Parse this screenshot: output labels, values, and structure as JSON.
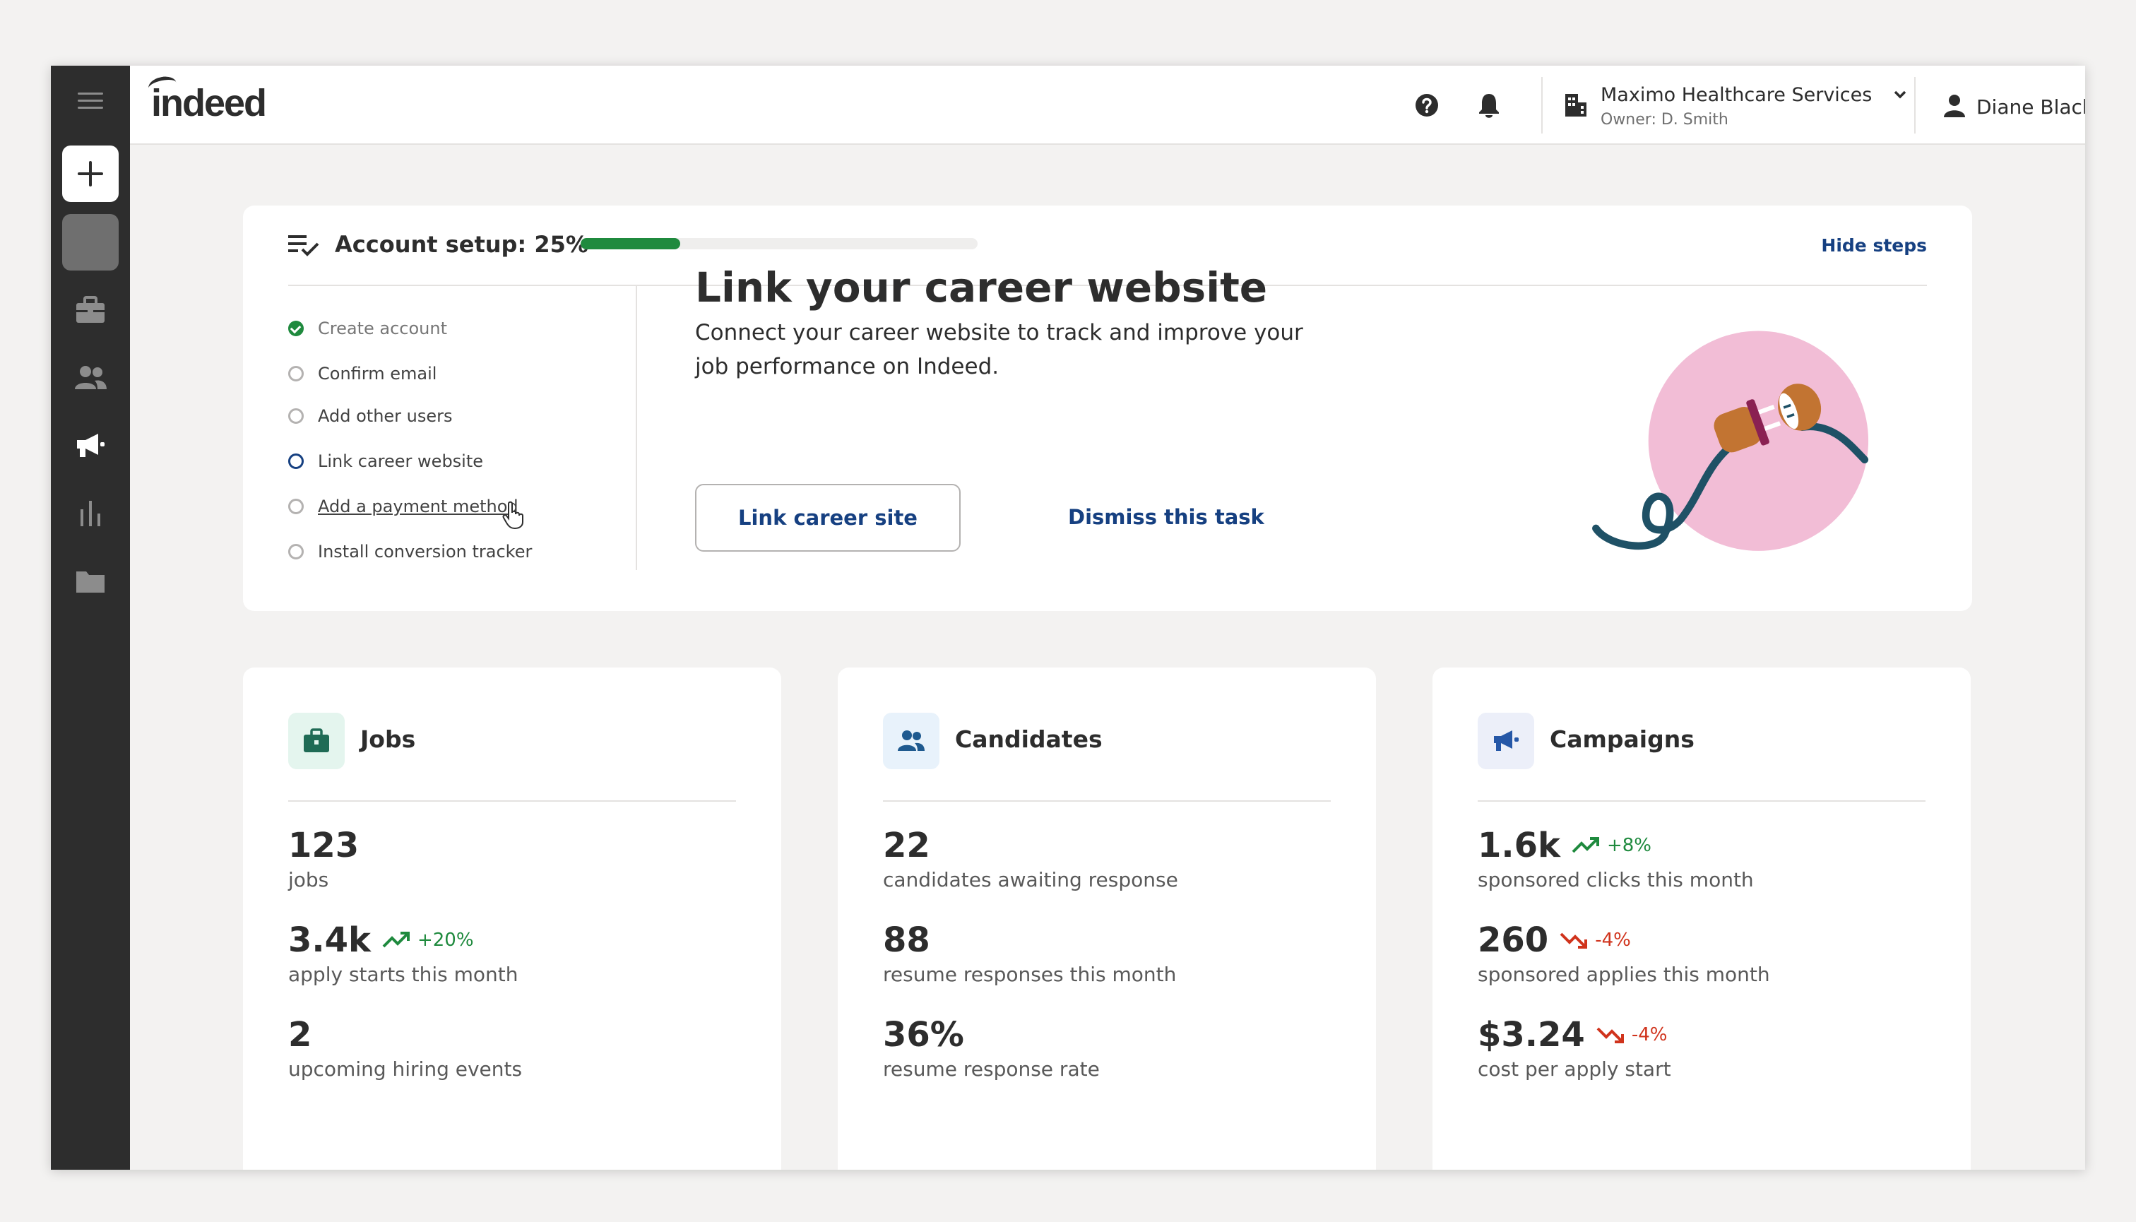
{
  "app": {
    "logo_text": "indeed"
  },
  "sidebar": {
    "items": [
      {
        "name": "menu",
        "icon": "hamburger-icon"
      },
      {
        "name": "create",
        "icon": "plus-icon"
      },
      {
        "name": "blank",
        "icon": ""
      },
      {
        "name": "jobs",
        "icon": "briefcase-icon"
      },
      {
        "name": "candidates",
        "icon": "people-icon"
      },
      {
        "name": "campaigns",
        "icon": "megaphone-icon"
      },
      {
        "name": "analytics",
        "icon": "bar-chart-icon"
      },
      {
        "name": "files",
        "icon": "folder-icon"
      }
    ]
  },
  "header": {
    "company_name": "Maximo Healthcare Services",
    "company_owner": "Owner: D. Smith",
    "user_name": "Diane Black"
  },
  "setup": {
    "title": "Account setup: 25%",
    "progress_fraction": 0.25,
    "hide_label": "Hide steps",
    "steps": [
      {
        "label": "Create account",
        "state": "done"
      },
      {
        "label": "Confirm email",
        "state": "todo"
      },
      {
        "label": "Add other users",
        "state": "todo"
      },
      {
        "label": "Link career website",
        "state": "active"
      },
      {
        "label": "Add a payment method",
        "state": "hover"
      },
      {
        "label": "Install conversion tracker",
        "state": "todo"
      }
    ],
    "task": {
      "title": "Link your career website",
      "description": "Connect your career website to track and improve your job performance on Indeed.",
      "primary_button": "Link career site",
      "secondary_button": "Dismiss this task"
    }
  },
  "cards": {
    "jobs": {
      "title": "Jobs",
      "stats": [
        {
          "value": "123",
          "caption": "jobs",
          "trend": ""
        },
        {
          "value": "3.4k",
          "caption": "apply starts this month",
          "trend": "+20%",
          "direction": "up"
        },
        {
          "value": "2",
          "caption": "upcoming hiring events",
          "trend": ""
        }
      ]
    },
    "candidates": {
      "title": "Candidates",
      "stats": [
        {
          "value": "22",
          "caption": "candidates awaiting response",
          "trend": ""
        },
        {
          "value": "88",
          "caption": "resume responses this month",
          "trend": ""
        },
        {
          "value": "36%",
          "caption": "resume response rate",
          "trend": ""
        }
      ]
    },
    "campaigns": {
      "title": "Campaigns",
      "stats": [
        {
          "value": "1.6k",
          "caption": "sponsored clicks this month",
          "trend": "+8%",
          "direction": "up"
        },
        {
          "value": "260",
          "caption": "sponsored applies this month",
          "trend": "-4%",
          "direction": "down"
        },
        {
          "value": "$3.24",
          "caption": "cost per apply start",
          "trend": "-4%",
          "direction": "down"
        }
      ]
    }
  },
  "colors": {
    "sidebar_bg": "#2d2d2d",
    "link_blue": "#164081",
    "success_green": "#1f8a3e",
    "danger_red": "#d0331c",
    "illustration_pink": "#f2bdd6"
  }
}
